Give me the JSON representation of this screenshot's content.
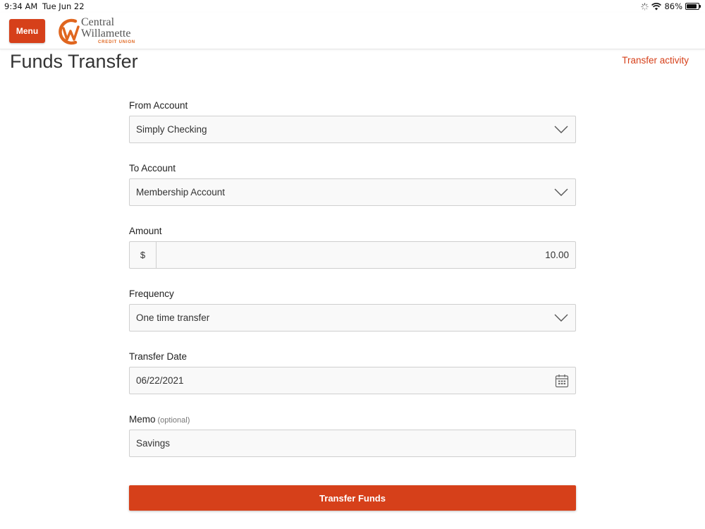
{
  "status_bar": {
    "time": "9:34 AM",
    "date": "Tue Jun 22",
    "battery_percent": "86%",
    "battery_level": 0.86
  },
  "header": {
    "menu_label": "Menu",
    "logo": {
      "line1": "Central",
      "line2": "Willamette",
      "line3": "CREDIT UNION"
    }
  },
  "page": {
    "title": "Funds Transfer",
    "activity_link": "Transfer activity"
  },
  "form": {
    "from_account": {
      "label": "From Account",
      "value": "Simply Checking"
    },
    "to_account": {
      "label": "To Account",
      "value": "Membership Account"
    },
    "amount": {
      "label": "Amount",
      "currency": "$",
      "value": "10.00"
    },
    "frequency": {
      "label": "Frequency",
      "value": "One time transfer"
    },
    "transfer_date": {
      "label": "Transfer Date",
      "value": "06/22/2021"
    },
    "memo": {
      "label": "Memo",
      "optional": "(optional)",
      "value": "Savings"
    },
    "submit_label": "Transfer Funds"
  },
  "colors": {
    "brand": "#d6401a",
    "logo_orange": "#e0661f"
  },
  "icons": [
    "loading-icon",
    "wifi-icon",
    "battery-icon",
    "chevron-down-icon",
    "calendar-icon"
  ]
}
